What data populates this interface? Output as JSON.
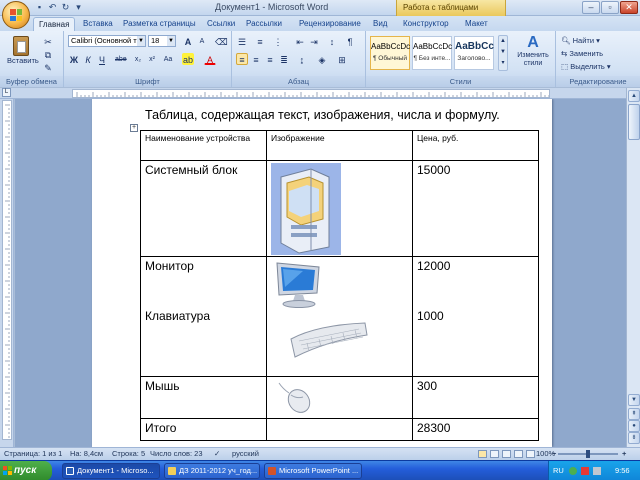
{
  "window": {
    "title": "Документ1 - Microsoft Word",
    "context_tab": "Работа с таблицами"
  },
  "quick_access": [
    "save-icon",
    "undo-icon",
    "redo-icon",
    "customize-icon"
  ],
  "tabs": [
    "Главная",
    "Вставка",
    "Разметка страницы",
    "Ссылки",
    "Рассылки",
    "Рецензирование",
    "Вид",
    "Конструктор",
    "Макет"
  ],
  "ribbon": {
    "clipboard": {
      "label": "Буфер обмена",
      "paste": "Вставить"
    },
    "font": {
      "label": "Шрифт",
      "name": "Calibri (Основной т",
      "size": "18"
    },
    "paragraph": {
      "label": "Абзац"
    },
    "styles": {
      "label": "Стили",
      "items": [
        {
          "sample": "AaBbCcDc",
          "name": "¶ Обычный"
        },
        {
          "sample": "AaBbCcDc",
          "name": "¶ Без инте..."
        },
        {
          "sample": "AaBbCc",
          "name": "Заголово..."
        }
      ],
      "change": "Изменить стили"
    },
    "editing": {
      "label": "Редактирование",
      "find": "Найти",
      "replace": "Заменить",
      "select": "Выделить"
    }
  },
  "document": {
    "heading": "Таблица, содержащая текст, изображения, числа и формулу.",
    "table": {
      "headers": [
        "Наименование устройства",
        "Изображение",
        "Цена, руб."
      ],
      "rows": [
        {
          "name": "Системный блок",
          "image": "system-unit-image",
          "price": "15000"
        },
        {
          "name": "Монитор",
          "image": "monitor-image",
          "price": "12000",
          "name2": "Клавиатура",
          "image2": "keyboard-image",
          "price2": "1000"
        },
        {
          "name": "Мышь",
          "image": "mouse-image",
          "price": "300"
        },
        {
          "name": "Итого",
          "image": "",
          "price": "28300"
        }
      ]
    }
  },
  "status": {
    "page": "Страница: 1 из 1",
    "position": "На: 8,4см",
    "line": "Строка: 5",
    "words": "Число слов: 23",
    "language": "русский",
    "zoom": "100%"
  },
  "taskbar": {
    "start": "пуск",
    "items": [
      "Документ1 - Microso...",
      "ДЗ 2011-2012 уч_год...",
      "Microsoft PowerPoint ..."
    ],
    "tray": {
      "lang": "RU",
      "time": "9:56"
    }
  },
  "colors": {
    "ribbon_bg": "#d3e2f4",
    "taskbar": "#245edb",
    "start": "#2f8a2b",
    "context_tab": "#eac85d"
  }
}
